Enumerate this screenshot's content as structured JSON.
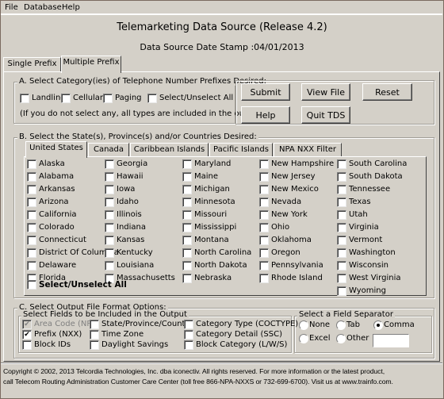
{
  "menu": [
    "File",
    "Database",
    "Help"
  ],
  "title": "Telemarketing Data Source (Release 4.2)",
  "date_stamp": "Data Source Date Stamp :04/01/2013",
  "main_tabs": [
    {
      "label": "Single Prefix",
      "selected": false
    },
    {
      "label": "Multiple Prefix",
      "selected": true
    }
  ],
  "section_a": {
    "legend": "A. Select Category(ies) of Telephone Number Prefixes Desired:",
    "options": [
      {
        "label": "Landline",
        "checked": false
      },
      {
        "label": "Cellular",
        "checked": false
      },
      {
        "label": "Paging",
        "checked": false
      },
      {
        "label": "Select/Unselect All",
        "checked": false
      }
    ],
    "note": "(If you do not select any, all types are included in the output.)"
  },
  "buttons": {
    "submit": "Submit",
    "view_file": "View File",
    "reset": "Reset",
    "help": "Help",
    "quit": "Quit TDS"
  },
  "section_b": {
    "legend": "B. Select the State(s), Province(s) and/or Countries Desired:",
    "tabs": [
      {
        "label": "United States",
        "selected": true
      },
      {
        "label": "Canada"
      },
      {
        "label": "Caribbean Islands"
      },
      {
        "label": "Pacific Islands"
      },
      {
        "label": "NPA NXX Filter"
      }
    ],
    "columns": [
      [
        "Alaska",
        "Alabama",
        "Arkansas",
        "Arizona",
        "California",
        "Colorado",
        "Connecticut",
        "District Of Columbia",
        "Delaware",
        "Florida"
      ],
      [
        "Georgia",
        "Hawaii",
        "Iowa",
        "Idaho",
        "Illinois",
        "Indiana",
        "Kansas",
        "Kentucky",
        "Louisiana",
        "Massachusetts"
      ],
      [
        "Maryland",
        "Maine",
        "Michigan",
        "Minnesota",
        "Missouri",
        "Mississippi",
        "Montana",
        "North Carolina",
        "North Dakota",
        "Nebraska"
      ],
      [
        "New Hampshire",
        "New Jersey",
        "New Mexico",
        "Nevada",
        "New York",
        "Ohio",
        "Oklahoma",
        "Oregon",
        "Pennsylvania",
        "Rhode Island"
      ],
      [
        "South Carolina",
        "South Dakota",
        "Tennessee",
        "Texas",
        "Utah",
        "Virginia",
        "Vermont",
        "Washington",
        "Wisconsin",
        "West Virginia",
        "Wyoming"
      ]
    ],
    "select_all": "Select/Unselect All"
  },
  "section_c": {
    "legend": "C. Select Output File Format Options:",
    "fields_legend": "Select Fields to be Included in the Output",
    "fields": [
      {
        "label": "Area Code (NPA)",
        "checked": true,
        "disabled": true
      },
      {
        "label": "Prefix (NXX)",
        "checked": true
      },
      {
        "label": "Block IDs",
        "checked": false
      },
      {
        "label": "State/Province/Country",
        "checked": false
      },
      {
        "label": "Time Zone",
        "checked": false
      },
      {
        "label": "Daylight Savings",
        "checked": false
      },
      {
        "label": "Category Type (COCTYPE)",
        "checked": false
      },
      {
        "label": "Category Detail (SSC)",
        "checked": false
      },
      {
        "label": "Block Category (L/W/S)",
        "checked": false
      }
    ],
    "separator_legend": "Select a Field Separator",
    "separators": [
      {
        "label": "None",
        "selected": false
      },
      {
        "label": "Tab",
        "selected": false
      },
      {
        "label": "Comma",
        "selected": true
      },
      {
        "label": "Excel",
        "selected": false
      },
      {
        "label": "Other",
        "selected": false
      }
    ],
    "other_value": ""
  },
  "footer": [
    "Copyright © 2002, 2013 Telcordia Technologies, Inc. dba iconectiv. All rights reserved. For more information or the latest product,",
    "call Telecom Routing Administration Customer Care Center (toll free 866-NPA-NXXS or 732-699-6700). Visit us at www.trainfo.com."
  ]
}
